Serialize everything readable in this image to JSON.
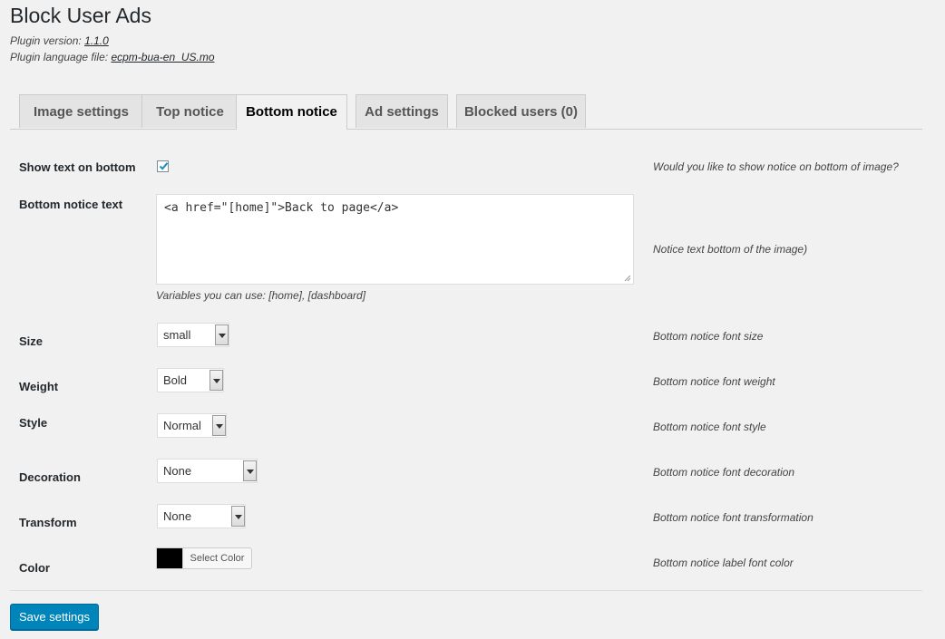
{
  "header": {
    "title": "Block User Ads",
    "version_label": "Plugin version:",
    "version_value": "1.1.0",
    "language_label": "Plugin language file:",
    "language_value": "ecpm-bua-en_US.mo"
  },
  "tabs": [
    {
      "label": "Image settings"
    },
    {
      "label": "Top notice"
    },
    {
      "label": "Bottom notice",
      "active": true
    },
    {
      "label": "Ad settings"
    },
    {
      "label": "Blocked users (0)"
    }
  ],
  "form": {
    "show_text": {
      "label": "Show text on bottom",
      "checked": true,
      "desc": "Would you like to show notice on bottom of image?"
    },
    "notice_text": {
      "label": "Bottom notice text",
      "value": "<a href=\"[home]\">Back to page</a>",
      "hint": "Variables you can use: [home], [dashboard]",
      "desc": "Notice text bottom of the image)"
    },
    "size": {
      "label": "Size",
      "value": "small",
      "desc": "Bottom notice font size"
    },
    "weight": {
      "label": "Weight",
      "value": "Bold",
      "desc": "Bottom notice font weight"
    },
    "style": {
      "label": "Style",
      "value": "Normal",
      "desc": "Bottom notice font style"
    },
    "decoration": {
      "label": "Decoration",
      "value": "None",
      "desc": "Bottom notice font decoration"
    },
    "transform": {
      "label": "Transform",
      "value": "None",
      "desc": "Bottom notice font transformation"
    },
    "color": {
      "label": "Color",
      "value": "#000000",
      "button_label": "Select Color",
      "desc": "Bottom notice label font color"
    }
  },
  "save_button": "Save settings",
  "colors": {
    "accent": "#0085ba",
    "background": "#f1f1f1"
  }
}
